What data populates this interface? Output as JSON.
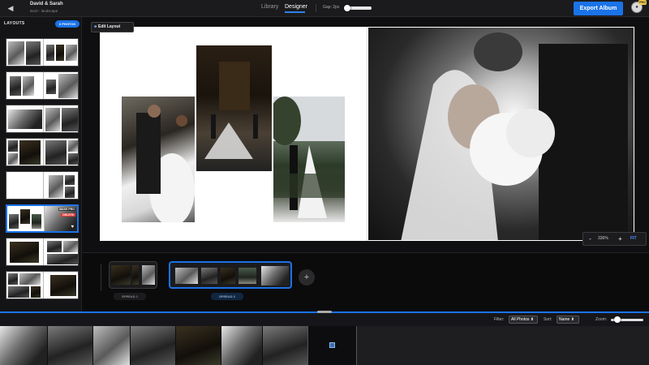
{
  "topbar": {
    "project_name": "David & Sarah",
    "project_subtitle": "8x10 - landscape",
    "tabs": [
      {
        "label": "Library"
      },
      {
        "label": "Designer"
      }
    ],
    "gap_label": "Gap: 2px",
    "export_label": "Export Album",
    "pro_badge": "PRO",
    "back_icon": "back-arrow-icon"
  },
  "sidebar": {
    "title": "LAYOUTS",
    "photos_badge": "6 PHOTOS",
    "make_pro_label": "MAKE PRO",
    "delete_label": "DELETE"
  },
  "canvas": {
    "edit_layout_label": "Edit Layout",
    "zoom": {
      "minus": "-",
      "value": "336%",
      "plus": "+",
      "fit": "FIT"
    }
  },
  "spreads": {
    "items": [
      {
        "label": "SPREAD 1"
      },
      {
        "label": "SPREAD 2"
      }
    ],
    "add_label": "+"
  },
  "filter_bar": {
    "filter_label": "Filter:",
    "filter_value": "All Photos",
    "sort_label": "Sort:",
    "sort_value": "Name",
    "zoom_label": "Zoom:"
  },
  "colors": {
    "accent": "#1a73e8",
    "background": "#0e0e10",
    "danger": "#e53935",
    "pro": "#f2c94c"
  }
}
